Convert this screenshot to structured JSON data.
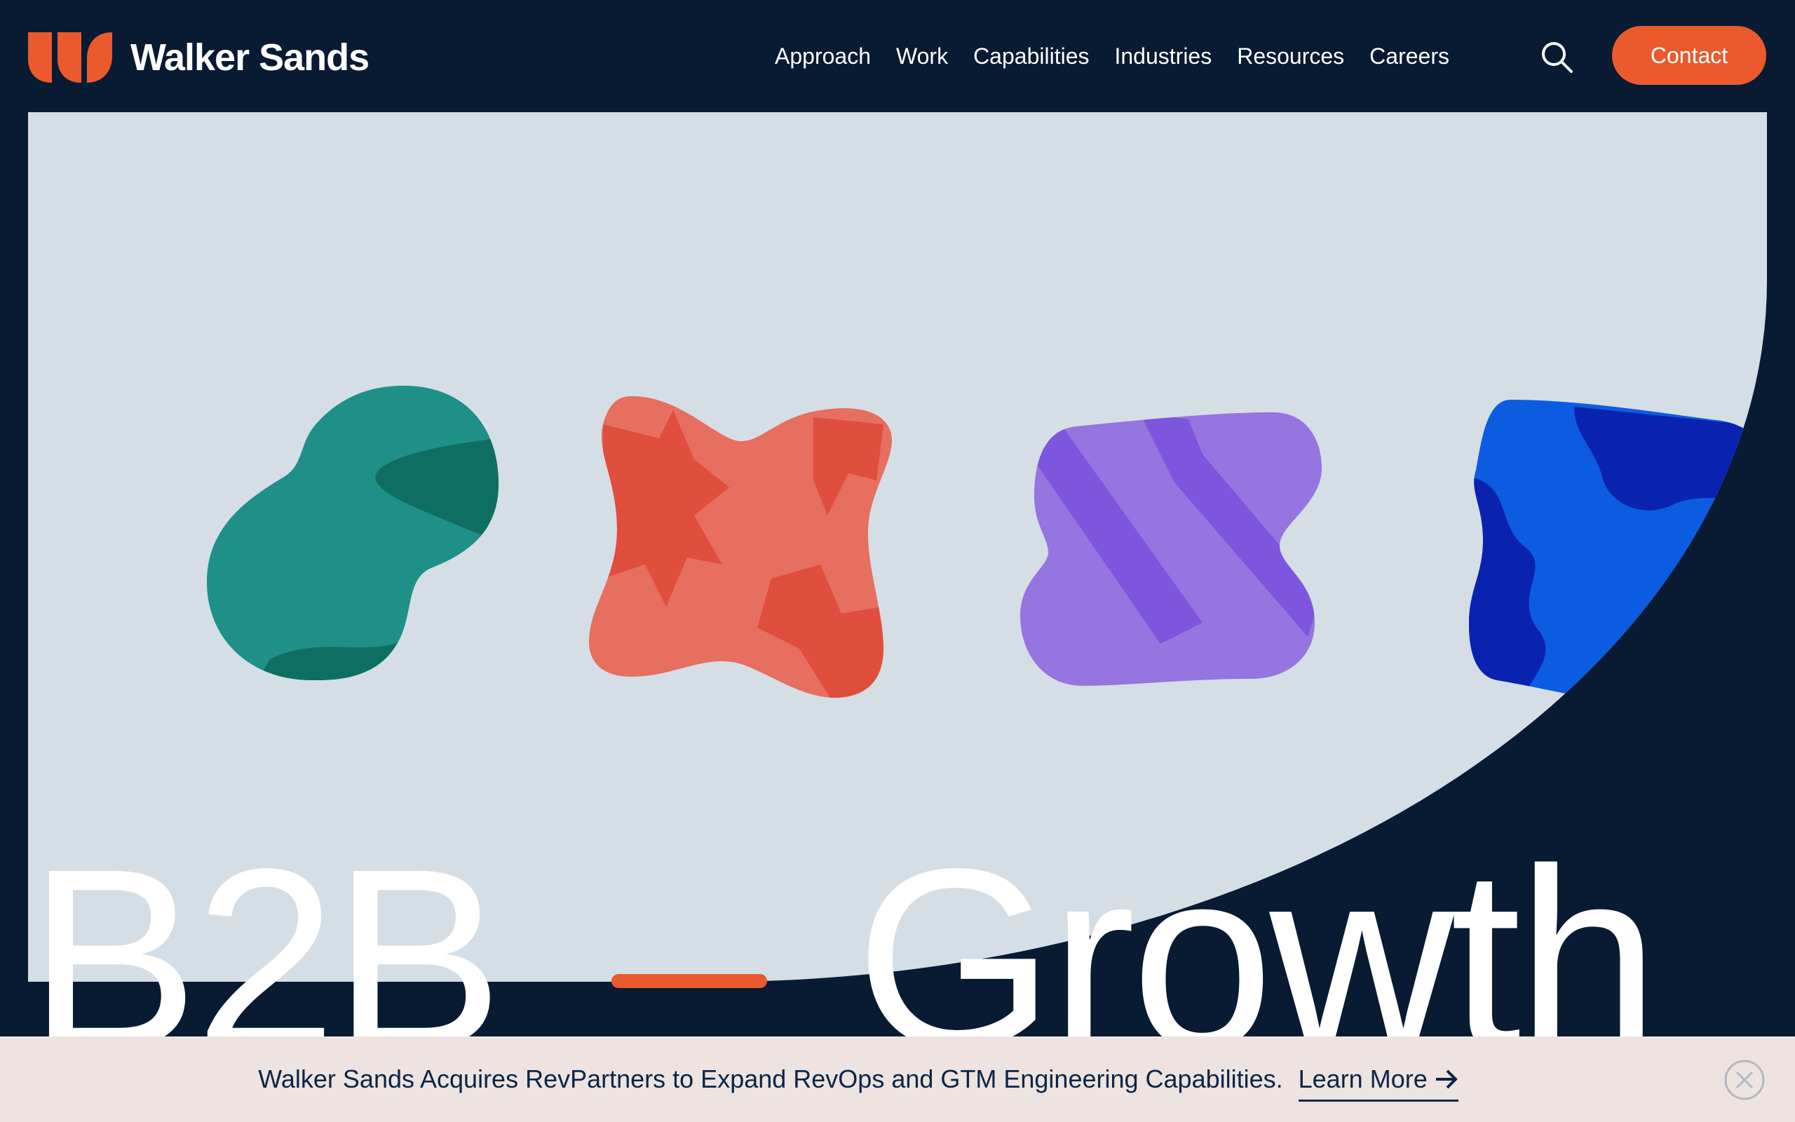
{
  "brand": {
    "name": "Walker Sands",
    "logo_icon": "walker-sands-logo-mark",
    "accent": "#ea5a2c",
    "navy": "#081b33"
  },
  "nav": {
    "items": [
      {
        "label": "Approach"
      },
      {
        "label": "Work"
      },
      {
        "label": "Capabilities"
      },
      {
        "label": "Industries"
      },
      {
        "label": "Resources"
      },
      {
        "label": "Careers"
      }
    ],
    "search_icon": "search-icon",
    "contact_label": "Contact"
  },
  "hero": {
    "headline_left": "B2B",
    "headline_right": "Growth",
    "shapes": [
      {
        "name": "green-blob",
        "colors": [
          "#1e9087",
          "#0f6e62"
        ]
      },
      {
        "name": "coral-blob",
        "colors": [
          "#e66f60",
          "#e04e3e"
        ]
      },
      {
        "name": "purple-blob",
        "colors": [
          "#9575df",
          "#7e55dd"
        ]
      },
      {
        "name": "blue-blob",
        "colors": [
          "#0b5ce0",
          "#0a22b0"
        ]
      }
    ]
  },
  "announcement": {
    "text": "Walker Sands Acquires RevPartners to Expand RevOps and GTM Engineering Capabilities.",
    "link_label": "Learn More",
    "link_icon": "arrow-right-icon",
    "close_icon": "close-icon"
  }
}
